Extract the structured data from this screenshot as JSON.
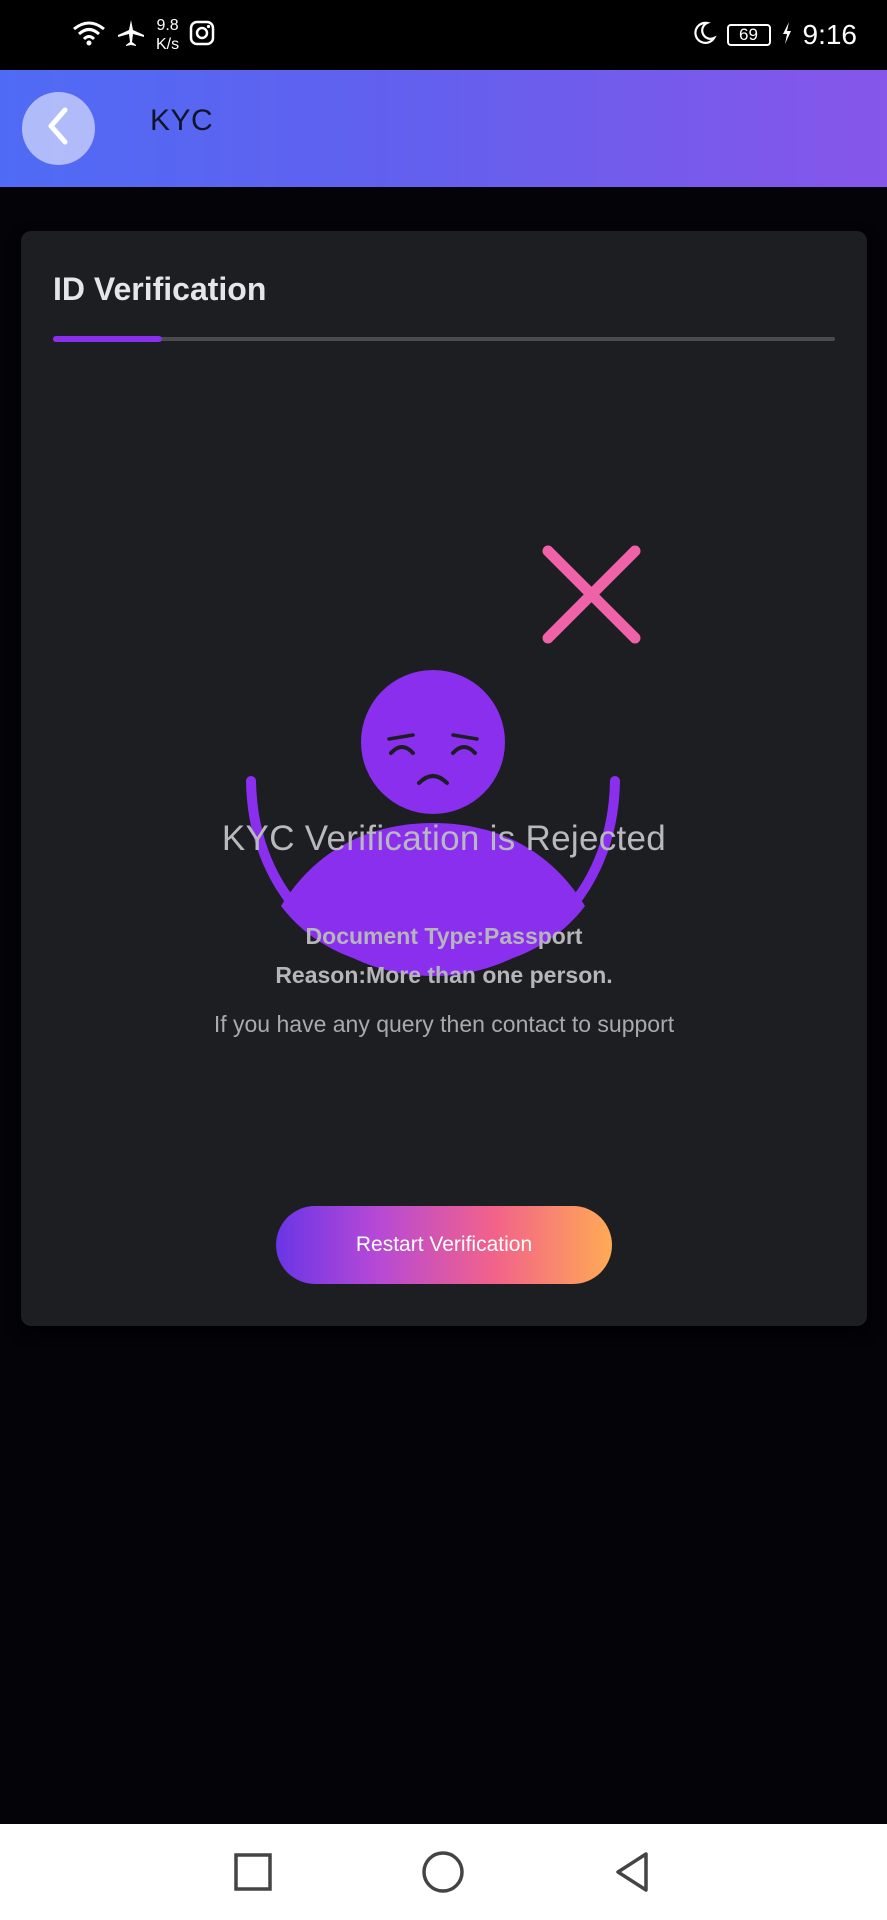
{
  "status_bar": {
    "net_speed_value": "9.8",
    "net_speed_unit": "K/s",
    "battery_level": "69",
    "time": "9:16"
  },
  "header": {
    "title": "KYC"
  },
  "card": {
    "title": "ID Verification",
    "progress_fraction": 0.14,
    "status_headline": "KYC Verification is Rejected",
    "document_type": "Document Type:Passport",
    "reason": "Reason:More than one person.",
    "support_note": "If you have any query then contact to support",
    "restart_button_label": "Restart Verification"
  },
  "colors": {
    "accent_purple": "#8b2fef",
    "reject_pink": "#f062a8",
    "header_gradient_start": "#4f6bf5",
    "header_gradient_end": "#8656ea"
  },
  "icons": {
    "wifi": "wifi-icon",
    "airplane": "airplane-icon",
    "instagram": "instagram-icon",
    "moon": "moon-icon",
    "charging": "charging-icon",
    "back": "chevron-left-icon",
    "reject": "close-x-icon",
    "nav_recent": "square-icon",
    "nav_home": "circle-icon",
    "nav_back": "triangle-back-icon"
  }
}
